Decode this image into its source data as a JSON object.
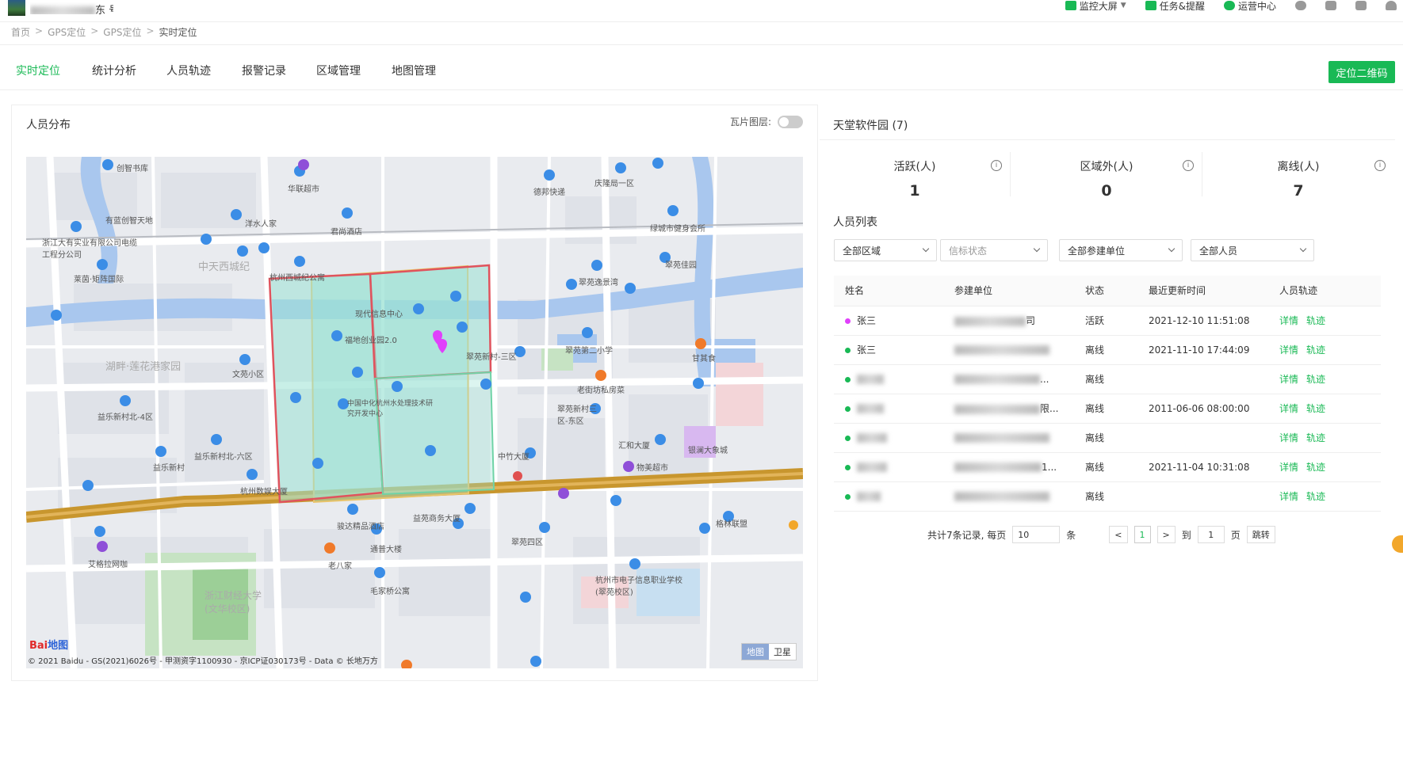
{
  "header": {
    "org_suffix": "东 号",
    "actions": [
      {
        "label": "监控大屏",
        "icon": "monitor-icon"
      },
      {
        "label": "任务&提醒",
        "icon": "task-icon"
      },
      {
        "label": "运营中心",
        "icon": "gear-icon"
      }
    ]
  },
  "breadcrumb": [
    "首页",
    "GPS定位",
    "GPS定位",
    "实时定位"
  ],
  "tabs": [
    "实时定位",
    "统计分析",
    "人员轨迹",
    "报警记录",
    "区域管理",
    "地图管理"
  ],
  "qr_button": "定位二维码",
  "left_panel": {
    "title": "人员分布",
    "tile_layer_label": "瓦片图层:",
    "tile_layer_on": false
  },
  "map": {
    "labels": [
      "创智书库",
      "华联超市",
      "德邦快递",
      "庆隆局一区",
      "有蓝创智天地",
      "洋水人家",
      "君尚酒店",
      "绿城市健身会所",
      "浙江大有实业有限公司电缆工程分公司",
      "中天西城纪",
      "杭州西城纪公寓",
      "翠苑逸景湾",
      "翠苑佳园",
      "莱茵·矩阵国际",
      "现代信息中心",
      "福地创业园2.0",
      "翠苑新村-三区",
      "翠苑第二小学",
      "甘其食",
      "湖畔·莲花港家园",
      "文苑小区",
      "中国中化杭州水处理技术研究开发中心",
      "老街坊私房菜",
      "翠苑新村三区-东区",
      "益乐新村北-4区",
      "汇和大厦",
      "银澜大象城",
      "益乐新村北-六区",
      "益乐新村",
      "物美超市",
      "中竹大厦",
      "杭州数娱大厦",
      "骏达精品酒店",
      "益苑商务大厦",
      "翠苑四区",
      "格林联盟",
      "老八家",
      "通普大楼",
      "浙江财经大学(文华校区)",
      "艾格拉网咖",
      "毛家桥公寓",
      "杭州市电子信息职业学校(翠苑校区)"
    ],
    "copyright": "© 2021 Baidu - GS(2021)6026号 - 甲测资字1100930 - 京ICP证030173号 - Data © 长地万方",
    "baidu_logo_a": "Bai",
    "baidu_logo_b": "地图",
    "map_type_map": "地图",
    "map_type_satellite": "卫星"
  },
  "right_panel": {
    "title": "天堂软件园 (7)",
    "stats": [
      {
        "label": "活跃(人)",
        "value": "1"
      },
      {
        "label": "区域外(人)",
        "value": "0"
      },
      {
        "label": "离线(人)",
        "value": "7"
      }
    ],
    "list_title": "人员列表",
    "filters": [
      "全部区域",
      "信标状态",
      "全部参建单位",
      "全部人员"
    ],
    "columns": [
      "姓名",
      "参建单位",
      "状态",
      "最近更新时间",
      "人员轨迹"
    ],
    "rows": [
      {
        "name": "张三",
        "unit_visible": "司",
        "status": "活跃",
        "time": "2021-12-10 11:51:08",
        "dot": "#e040fb"
      },
      {
        "name": "张三",
        "unit_visible": "",
        "status": "离线",
        "time": "2021-11-10 17:44:09",
        "dot": "#19b955"
      },
      {
        "name": "",
        "unit_visible": "...",
        "status": "离线",
        "time": "",
        "dot": "#19b955"
      },
      {
        "name": "",
        "unit_visible": "限...",
        "status": "离线",
        "time": "2011-06-06 08:00:00",
        "dot": "#19b955"
      },
      {
        "name": "",
        "unit_visible": "",
        "status": "离线",
        "time": "",
        "dot": "#19b955"
      },
      {
        "name": "",
        "unit_visible": "1...",
        "status": "离线",
        "time": "2021-11-04 10:31:08",
        "dot": "#19b955"
      },
      {
        "name": "",
        "unit_visible": "",
        "status": "离线",
        "time": "",
        "dot": "#19b955"
      }
    ],
    "link_detail": "详情",
    "link_track": "轨迹",
    "pager": {
      "total_text": "共计7条记录, 每页",
      "page_size": "10",
      "unit": "条",
      "current_page": "1",
      "goto_label": "到",
      "goto_value": "1",
      "page_label": "页",
      "jump_label": "跳转"
    }
  },
  "colors": {
    "accent": "#19b955",
    "active_dot": "#e040fb",
    "zone_red": "#e0535d",
    "zone_green": "#6fd3a6"
  }
}
